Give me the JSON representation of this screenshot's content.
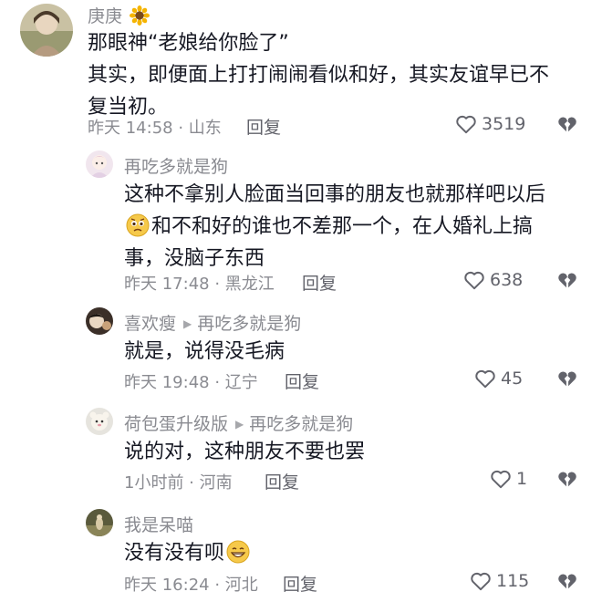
{
  "comments": [
    {
      "username": "庚庚",
      "username_emoji": "sunflower-icon",
      "lines": [
        "那眼神“老娘给你脸了”",
        "其实，即便面上打打闹闹看似和好，其实友谊早已不",
        "复当初。"
      ],
      "time": "昨天 14:58 · 山东",
      "reply_label": "回复",
      "likes": "3519"
    },
    {
      "username": "再吃多就是狗",
      "lines": [
        "这种不拿别人脸面当回事的朋友也就那样吧以后",
        "和不和好的谁也不差那一个，在人婚礼上搞",
        "事，没脑子东西"
      ],
      "time": "昨天 17:48 · 黑龙江",
      "reply_label": "回复",
      "likes": "638"
    },
    {
      "username": "喜欢瘦",
      "reply_to": "再吃多就是狗",
      "lines": [
        "就是，说得没毛病"
      ],
      "time": "昨天 19:48 · 辽宁",
      "reply_label": "回复",
      "likes": "45"
    },
    {
      "username": "荷包蛋升级版",
      "reply_to": "再吃多就是狗",
      "lines": [
        "说的对，这种朋友不要也罢"
      ],
      "time": "1小时前 · 河南",
      "reply_label": "回复",
      "likes": "1"
    },
    {
      "username": "我是呆喵",
      "lines": [
        "没有没有呗"
      ],
      "time": "昨天 16:24 · 河北",
      "reply_label": "回复",
      "likes": "115"
    }
  ],
  "colors": {
    "text": "#161823",
    "secondary": "#8a8b91",
    "icon": "#62636b"
  }
}
